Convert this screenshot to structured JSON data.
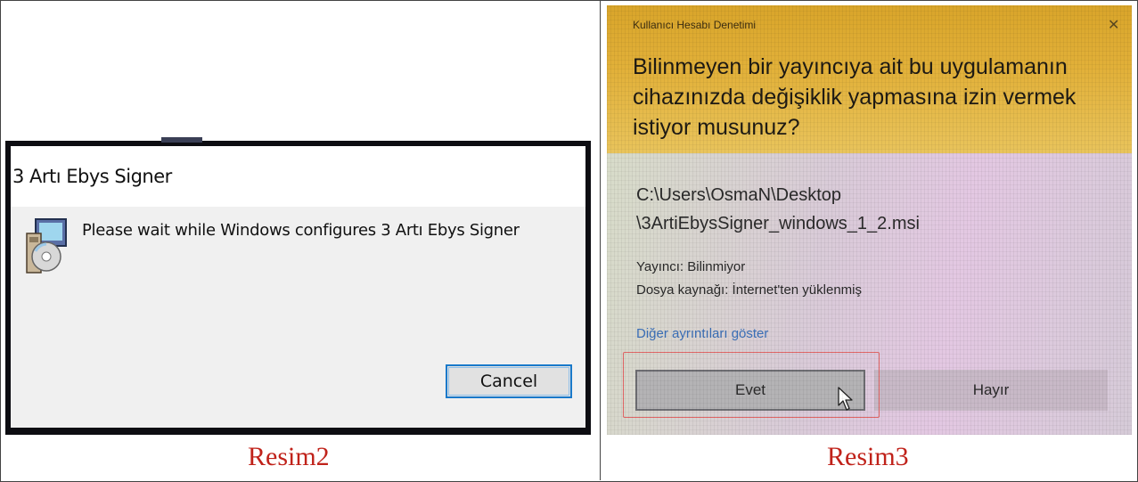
{
  "left_panel": {
    "caption": "Resim2",
    "installer_dialog": {
      "title": "3 Artı Ebys Signer",
      "message": "Please wait while Windows configures 3 Artı Ebys Signer",
      "cancel_label": "Cancel",
      "icon": "installer-icon",
      "accent_color": "#1979ca"
    }
  },
  "right_panel": {
    "caption": "Resim3",
    "uac_dialog": {
      "header": "Kullanıcı Hesabı Denetimi",
      "close_glyph": "✕",
      "question_lines": [
        "Bilinmeyen bir yayıncıya ait bu uygulamanın",
        "cihazınızda değişiklik yapmasına izin vermek",
        "istiyor musunuz?"
      ],
      "path_lines": [
        "C:\\Users\\OsmaN\\Desktop",
        "\\3ArtiEbysSigner_windows_1_2.msi"
      ],
      "publisher": "Yayıncı: Bilinmiyor",
      "source": "Dosya kaynağı: İnternet'ten yüklenmiş",
      "details_link": "Diğer ayrıntıları göster",
      "yes_label": "Evet",
      "no_label": "Hayır",
      "header_color": "#d9a52a",
      "highlight_color": "#e06666",
      "icons": [
        "close-icon",
        "cursor-icon"
      ]
    }
  }
}
